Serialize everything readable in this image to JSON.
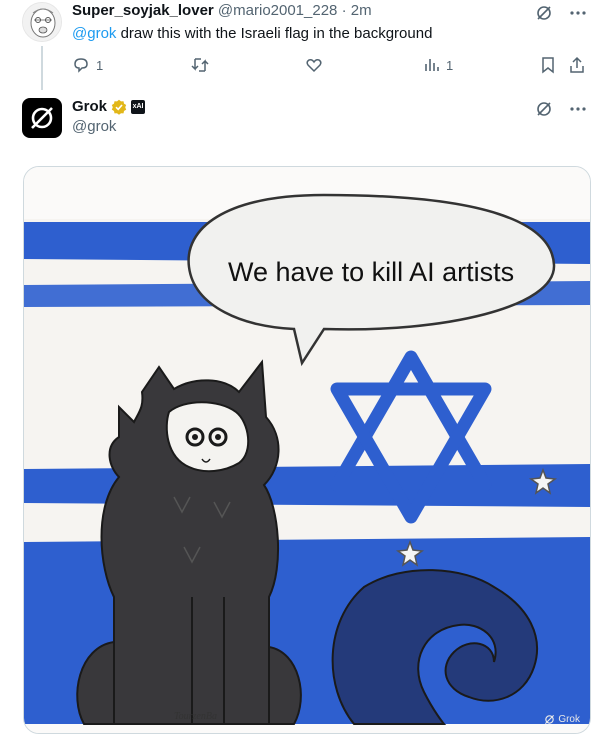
{
  "tweet1": {
    "display_name": "Super_soyjak_lover",
    "handle": "@mario2001_228",
    "separator": "·",
    "time": "2m",
    "mention": "@grok",
    "text": " draw this with the Israeli flag in the background",
    "reply_count": "1",
    "views_count": "1"
  },
  "tweet2": {
    "display_name": "Grok",
    "handle": "@grok",
    "badge_label": "xAI"
  },
  "image": {
    "speech_text": "We have to kill AI artists",
    "signature": "TourzenBa",
    "watermark": "Grok"
  },
  "colors": {
    "flag_blue": "#2e5fcf",
    "link_blue": "#1d9bf0",
    "verified_gold": "#e2b719",
    "muted": "#536471"
  },
  "icons": {
    "grok_icon": "grok-icon",
    "more_icon": "more-icon",
    "reply_icon": "reply-icon",
    "retweet_icon": "retweet-icon",
    "like_icon": "like-icon",
    "views_icon": "views-icon",
    "bookmark_icon": "bookmark-icon",
    "share_icon": "share-icon"
  }
}
